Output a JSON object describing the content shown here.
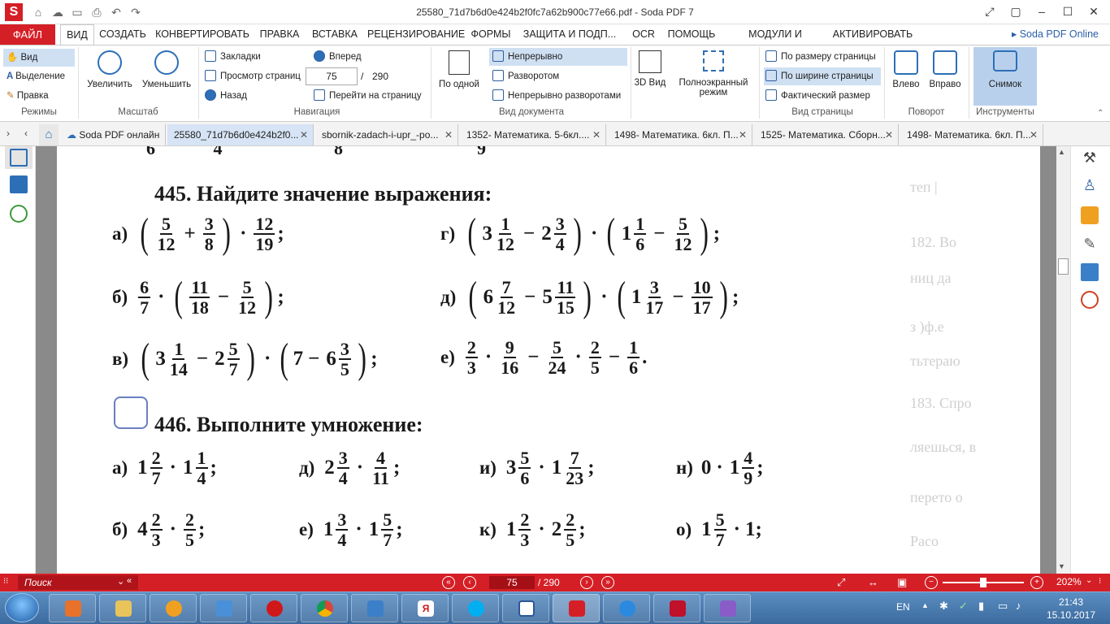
{
  "window": {
    "title": "25580_71d7b6d0e424b2f0fc7a62b900c77e66.pdf  -  Soda PDF 7",
    "logo": "S"
  },
  "quick_access": [
    "home-icon",
    "cloud-icon",
    "folder-icon",
    "save-icon",
    "print-icon",
    "undo-icon",
    "redo-icon"
  ],
  "menu": {
    "file": "ФАЙЛ",
    "items": [
      "ВИД",
      "СОЗДАТЬ",
      "КОНВЕРТИРОВАТЬ",
      "ПРАВКА",
      "ВСТАВКА",
      "РЕЦЕНЗИРОВАНИЕ",
      "ФОРМЫ",
      "ЗАЩИТА И ПОДП...",
      "OCR",
      "ПОМОЩЬ",
      "МОДУЛИ И ПАКЕТЫ",
      "АКТИВИРОВАТЬ"
    ],
    "active": "ВИД",
    "online": "Soda PDF Online"
  },
  "ribbon": {
    "modes": {
      "items": [
        "Вид",
        "Выделение",
        "Правка"
      ],
      "label": "Режимы"
    },
    "scale": {
      "zoom_in": "Увеличить",
      "zoom_out": "Уменьшить",
      "label": "Масштаб"
    },
    "navigation": {
      "bookmarks": "Закладки",
      "pages": "Просмотр страниц",
      "back": "Назад",
      "forward": "Вперед",
      "page_value": "75",
      "page_sep": "/",
      "page_total": "290",
      "goto": "Перейти на страницу",
      "label": "Навигация"
    },
    "docview": {
      "single": "По одной",
      "continuous": "Непрерывно",
      "spread": "Разворотом",
      "cont_spread": "Непрерывно разворотами",
      "label": "Вид документа"
    },
    "view3d": "3D Вид",
    "fullscreen": "Полноэкранный режим",
    "pageview": {
      "fit_page": "По размеру страницы",
      "fit_width": "По ширине страницы",
      "actual": "Фактический размер",
      "label": "Вид страницы"
    },
    "rotate": {
      "left": "Влево",
      "right": "Вправо",
      "label": "Поворот"
    },
    "tools": {
      "snapshot": "Снимок",
      "label": "Инструменты"
    }
  },
  "tabs": [
    "Soda PDF онлайн",
    "25580_71d7b6d0e424b2f0...",
    "sbornik-zadach-i-upr_-ро...",
    "1352- Математика. 5-6кл....",
    "1498- Математика. 6кл. П...",
    "1525- Математика. Сборн...",
    "1498- Математика. 6кл. П..."
  ],
  "page": {
    "p445_title": "445. Найдите значение выражения:",
    "p446_title": "446. Выполните умножение:",
    "p445": [
      {
        "label": "а)"
      },
      {
        "label": "г)"
      },
      {
        "label": "б)"
      },
      {
        "label": "д)"
      },
      {
        "label": "в)"
      },
      {
        "label": "е)"
      }
    ],
    "p446": [
      {
        "label": "а)",
        "text_tail": ";"
      },
      {
        "label": "д)"
      },
      {
        "label": "и)"
      },
      {
        "label": "н)"
      },
      {
        "label": "б)"
      },
      {
        "label": "е)"
      },
      {
        "label": "к)"
      },
      {
        "label": "о)"
      }
    ],
    "bleed_text": [
      "теп | ",
      "182. Во",
      "ниц  да",
      "з )ф.е",
      "тьтераю",
      "183. Спро",
      "ляешься, в",
      "перето о",
      "Расо"
    ]
  },
  "statusbar": {
    "search_placeholder": "Поиск",
    "page_value": "75",
    "page_total": "/ 290",
    "zoom": "202%"
  },
  "taskbar": {
    "lang": "EN",
    "time": "21:43",
    "date": "15.10.2017"
  }
}
